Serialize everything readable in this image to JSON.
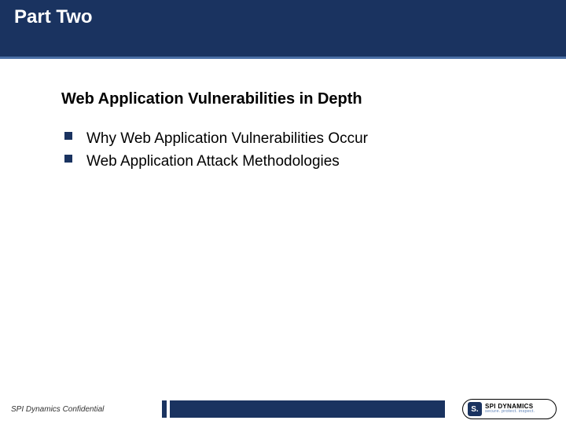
{
  "header": {
    "title": "Part Two"
  },
  "subtitle": "Web Application Vulnerabilities in Depth",
  "bullets": [
    "Why Web Application Vulnerabilities Occur",
    "Web Application Attack Methodologies"
  ],
  "footer": {
    "confidential": "SPI Dynamics Confidential",
    "logo": {
      "mark": "S.",
      "line1": "SPI DYNAMICS",
      "line2": "secure. protect. inspect."
    }
  }
}
